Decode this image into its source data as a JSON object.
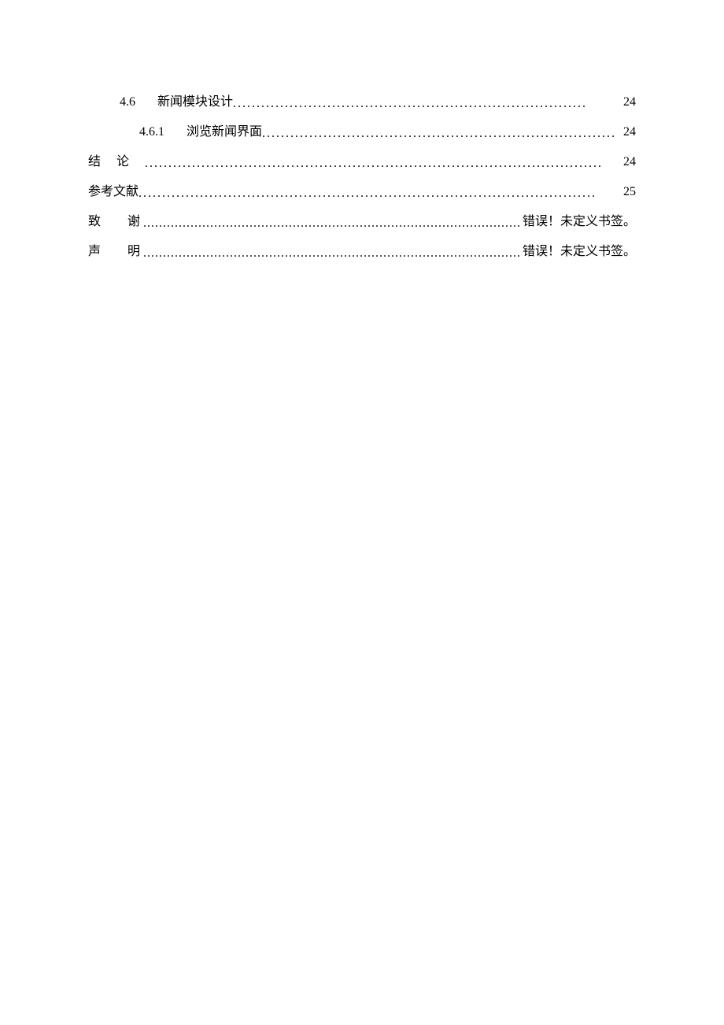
{
  "toc": {
    "items": [
      {
        "label": "4.6",
        "title": "新闻模块设计",
        "page": "24",
        "indent": 1,
        "labelGap": true,
        "spaced": false
      },
      {
        "label": "4.6.1",
        "title": "浏览新闻界面",
        "page": "24",
        "indent": 2,
        "labelGap": true,
        "spaced": false
      },
      {
        "label": "",
        "title": "结　论",
        "page": "24",
        "indent": 0,
        "labelGap": false,
        "spaced": true
      },
      {
        "label": "",
        "title": "参考文献",
        "page": "25",
        "indent": 0,
        "labelGap": false,
        "spaced": false
      },
      {
        "label": "",
        "title": "致　谢",
        "page": "错误！未定义书签。",
        "indent": 0,
        "labelGap": false,
        "spaced": true,
        "spaceAfter": true
      },
      {
        "label": "",
        "title": "声　明",
        "page": "错误！未定义书签。",
        "indent": 0,
        "labelGap": false,
        "spaced": true,
        "spaceAfter": true
      }
    ]
  }
}
